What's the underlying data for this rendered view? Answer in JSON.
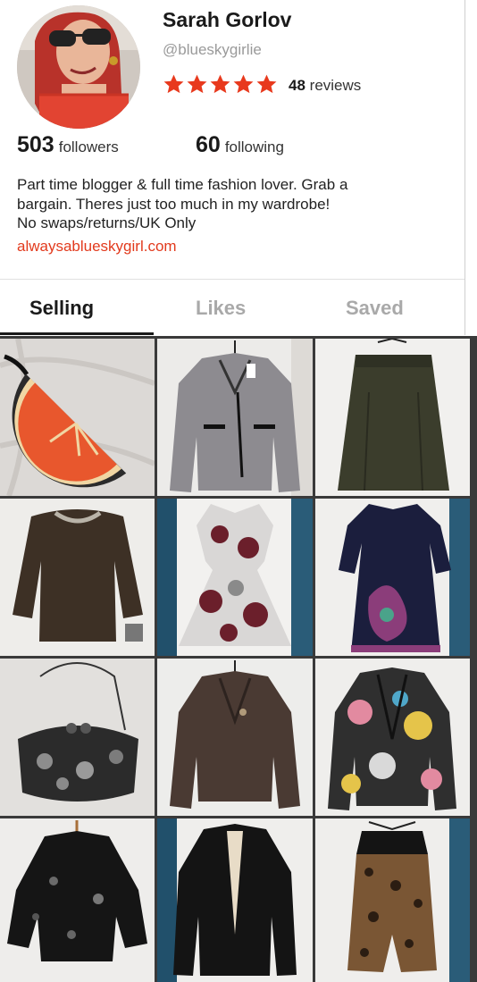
{
  "profile": {
    "name": "Sarah Gorlov",
    "handle": "@blueskygirlie",
    "rating_stars": 5,
    "reviews_count": "48",
    "reviews_label": "reviews",
    "followers_count": "503",
    "followers_label": "followers",
    "following_count": "60",
    "following_label": "following",
    "bio_line1": "Part time blogger & full time fashion lover. Grab a",
    "bio_line2": "bargain. Theres just too much in my wardrobe!",
    "bio_line3": "No swaps/returns/UK Only",
    "website": "alwaysablueskygirl.com"
  },
  "tabs": [
    {
      "label": "Selling",
      "active": true
    },
    {
      "label": "Likes",
      "active": false
    },
    {
      "label": "Saved",
      "active": false
    }
  ],
  "colors": {
    "accent": "#e23a1d",
    "star": "#e8391d",
    "text": "#1a1a1a",
    "muted": "#9a9a9a"
  },
  "listings": [
    {
      "item": "orange-slice-clutch-bag"
    },
    {
      "item": "grey-biker-jacket"
    },
    {
      "item": "khaki-leather-skirt"
    },
    {
      "item": "brown-embellished-jumper"
    },
    {
      "item": "floral-skater-dress"
    },
    {
      "item": "navy-print-shift-dress"
    },
    {
      "item": "sequin-clasp-bag"
    },
    {
      "item": "brown-tweed-jacket"
    },
    {
      "item": "floral-print-blazer"
    },
    {
      "item": "black-sequin-jacket"
    },
    {
      "item": "black-blazer"
    },
    {
      "item": "leopard-playsuit"
    }
  ]
}
